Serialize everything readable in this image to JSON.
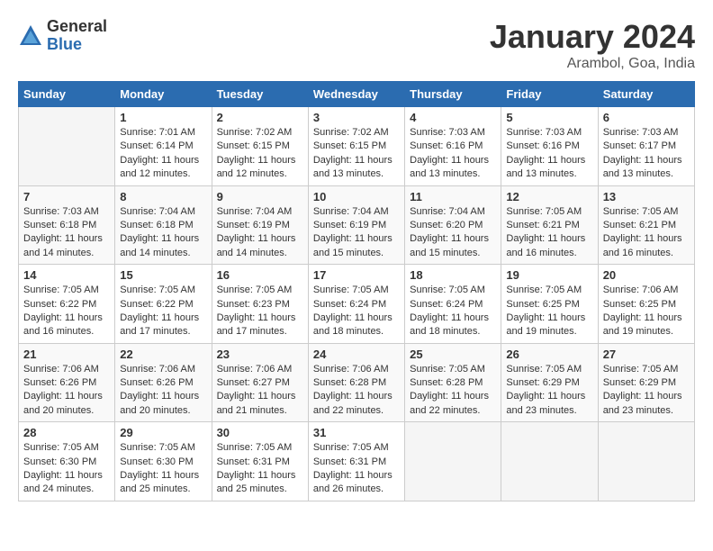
{
  "header": {
    "logo_general": "General",
    "logo_blue": "Blue",
    "month_title": "January 2024",
    "location": "Arambol, Goa, India"
  },
  "weekdays": [
    "Sunday",
    "Monday",
    "Tuesday",
    "Wednesday",
    "Thursday",
    "Friday",
    "Saturday"
  ],
  "weeks": [
    [
      {
        "day": "",
        "sunrise": "",
        "sunset": "",
        "daylight": ""
      },
      {
        "day": "1",
        "sunrise": "7:01 AM",
        "sunset": "6:14 PM",
        "daylight": "11 hours and 12 minutes."
      },
      {
        "day": "2",
        "sunrise": "7:02 AM",
        "sunset": "6:15 PM",
        "daylight": "11 hours and 12 minutes."
      },
      {
        "day": "3",
        "sunrise": "7:02 AM",
        "sunset": "6:15 PM",
        "daylight": "11 hours and 13 minutes."
      },
      {
        "day": "4",
        "sunrise": "7:03 AM",
        "sunset": "6:16 PM",
        "daylight": "11 hours and 13 minutes."
      },
      {
        "day": "5",
        "sunrise": "7:03 AM",
        "sunset": "6:16 PM",
        "daylight": "11 hours and 13 minutes."
      },
      {
        "day": "6",
        "sunrise": "7:03 AM",
        "sunset": "6:17 PM",
        "daylight": "11 hours and 13 minutes."
      }
    ],
    [
      {
        "day": "7",
        "sunrise": "7:03 AM",
        "sunset": "6:18 PM",
        "daylight": "11 hours and 14 minutes."
      },
      {
        "day": "8",
        "sunrise": "7:04 AM",
        "sunset": "6:18 PM",
        "daylight": "11 hours and 14 minutes."
      },
      {
        "day": "9",
        "sunrise": "7:04 AM",
        "sunset": "6:19 PM",
        "daylight": "11 hours and 14 minutes."
      },
      {
        "day": "10",
        "sunrise": "7:04 AM",
        "sunset": "6:19 PM",
        "daylight": "11 hours and 15 minutes."
      },
      {
        "day": "11",
        "sunrise": "7:04 AM",
        "sunset": "6:20 PM",
        "daylight": "11 hours and 15 minutes."
      },
      {
        "day": "12",
        "sunrise": "7:05 AM",
        "sunset": "6:21 PM",
        "daylight": "11 hours and 16 minutes."
      },
      {
        "day": "13",
        "sunrise": "7:05 AM",
        "sunset": "6:21 PM",
        "daylight": "11 hours and 16 minutes."
      }
    ],
    [
      {
        "day": "14",
        "sunrise": "7:05 AM",
        "sunset": "6:22 PM",
        "daylight": "11 hours and 16 minutes."
      },
      {
        "day": "15",
        "sunrise": "7:05 AM",
        "sunset": "6:22 PM",
        "daylight": "11 hours and 17 minutes."
      },
      {
        "day": "16",
        "sunrise": "7:05 AM",
        "sunset": "6:23 PM",
        "daylight": "11 hours and 17 minutes."
      },
      {
        "day": "17",
        "sunrise": "7:05 AM",
        "sunset": "6:24 PM",
        "daylight": "11 hours and 18 minutes."
      },
      {
        "day": "18",
        "sunrise": "7:05 AM",
        "sunset": "6:24 PM",
        "daylight": "11 hours and 18 minutes."
      },
      {
        "day": "19",
        "sunrise": "7:05 AM",
        "sunset": "6:25 PM",
        "daylight": "11 hours and 19 minutes."
      },
      {
        "day": "20",
        "sunrise": "7:06 AM",
        "sunset": "6:25 PM",
        "daylight": "11 hours and 19 minutes."
      }
    ],
    [
      {
        "day": "21",
        "sunrise": "7:06 AM",
        "sunset": "6:26 PM",
        "daylight": "11 hours and 20 minutes."
      },
      {
        "day": "22",
        "sunrise": "7:06 AM",
        "sunset": "6:26 PM",
        "daylight": "11 hours and 20 minutes."
      },
      {
        "day": "23",
        "sunrise": "7:06 AM",
        "sunset": "6:27 PM",
        "daylight": "11 hours and 21 minutes."
      },
      {
        "day": "24",
        "sunrise": "7:06 AM",
        "sunset": "6:28 PM",
        "daylight": "11 hours and 22 minutes."
      },
      {
        "day": "25",
        "sunrise": "7:05 AM",
        "sunset": "6:28 PM",
        "daylight": "11 hours and 22 minutes."
      },
      {
        "day": "26",
        "sunrise": "7:05 AM",
        "sunset": "6:29 PM",
        "daylight": "11 hours and 23 minutes."
      },
      {
        "day": "27",
        "sunrise": "7:05 AM",
        "sunset": "6:29 PM",
        "daylight": "11 hours and 23 minutes."
      }
    ],
    [
      {
        "day": "28",
        "sunrise": "7:05 AM",
        "sunset": "6:30 PM",
        "daylight": "11 hours and 24 minutes."
      },
      {
        "day": "29",
        "sunrise": "7:05 AM",
        "sunset": "6:30 PM",
        "daylight": "11 hours and 25 minutes."
      },
      {
        "day": "30",
        "sunrise": "7:05 AM",
        "sunset": "6:31 PM",
        "daylight": "11 hours and 25 minutes."
      },
      {
        "day": "31",
        "sunrise": "7:05 AM",
        "sunset": "6:31 PM",
        "daylight": "11 hours and 26 minutes."
      },
      {
        "day": "",
        "sunrise": "",
        "sunset": "",
        "daylight": ""
      },
      {
        "day": "",
        "sunrise": "",
        "sunset": "",
        "daylight": ""
      },
      {
        "day": "",
        "sunrise": "",
        "sunset": "",
        "daylight": ""
      }
    ]
  ]
}
